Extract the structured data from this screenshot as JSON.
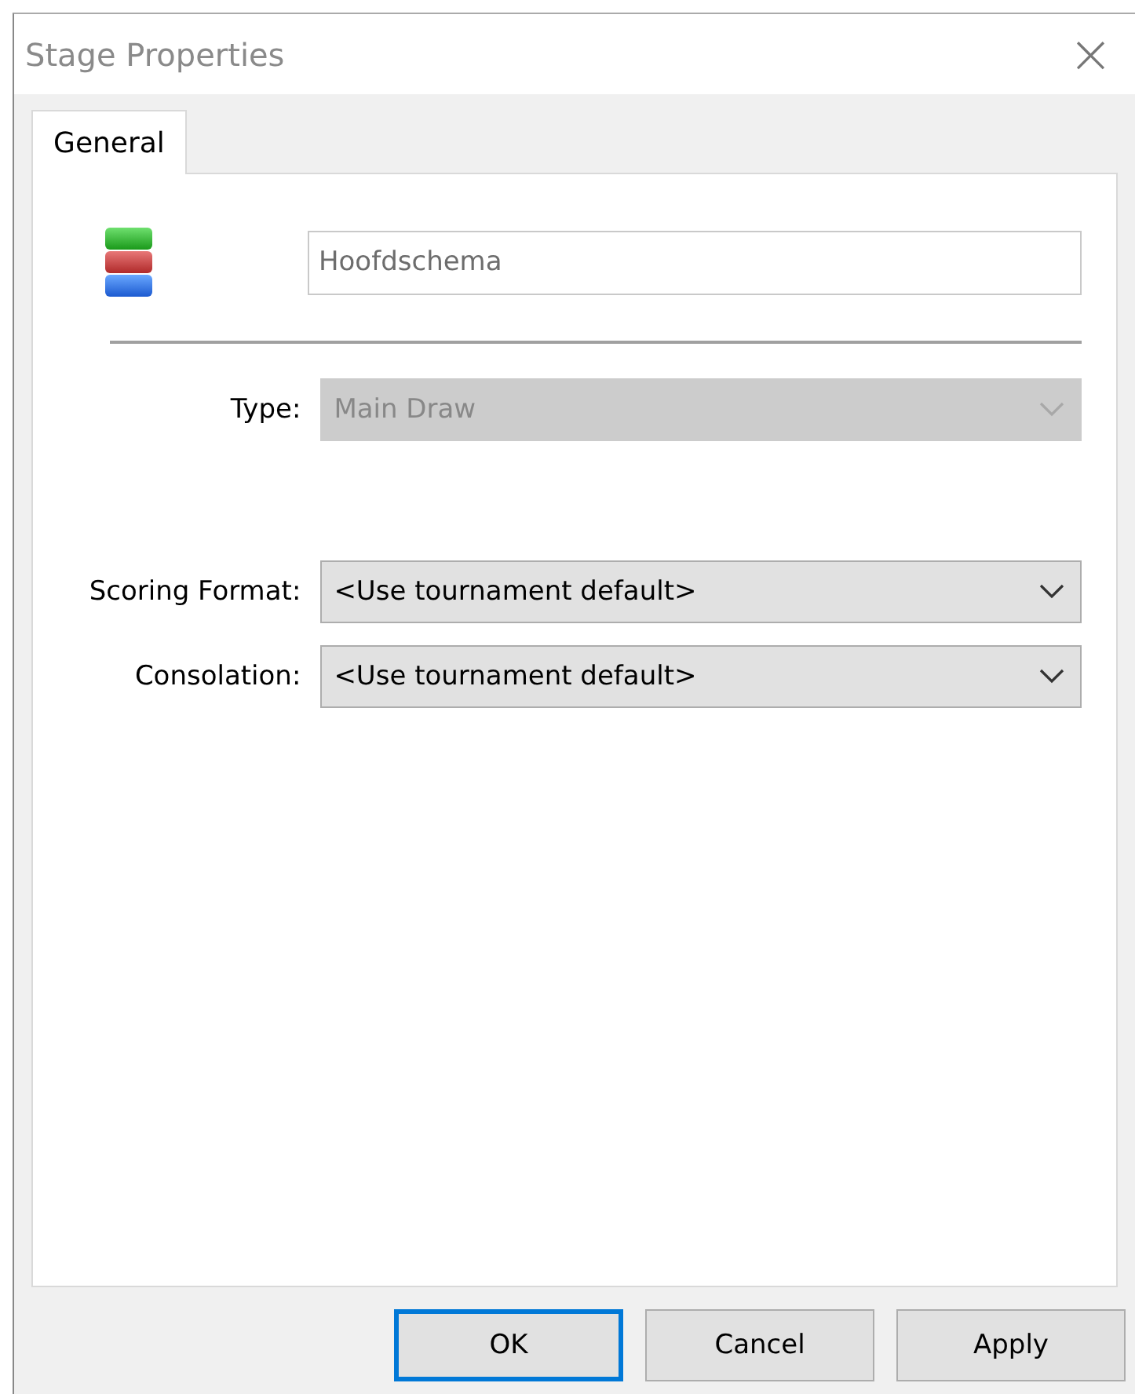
{
  "window": {
    "title": "Stage Properties",
    "close": "×"
  },
  "tabs": [
    {
      "label": "General",
      "selected": true
    }
  ],
  "name_field": {
    "value": "Hoofdschema"
  },
  "fields": [
    {
      "label": "Type:",
      "value": "Main Draw",
      "disabled": true
    },
    {
      "label": "Scoring Format:",
      "value": "<Use tournament default>",
      "disabled": false
    },
    {
      "label": "Consolation:",
      "value": "<Use tournament default>",
      "disabled": false
    }
  ],
  "buttons": [
    {
      "label": "OK",
      "default": true
    },
    {
      "label": "Cancel",
      "default": false
    },
    {
      "label": "Apply",
      "default": false
    }
  ]
}
